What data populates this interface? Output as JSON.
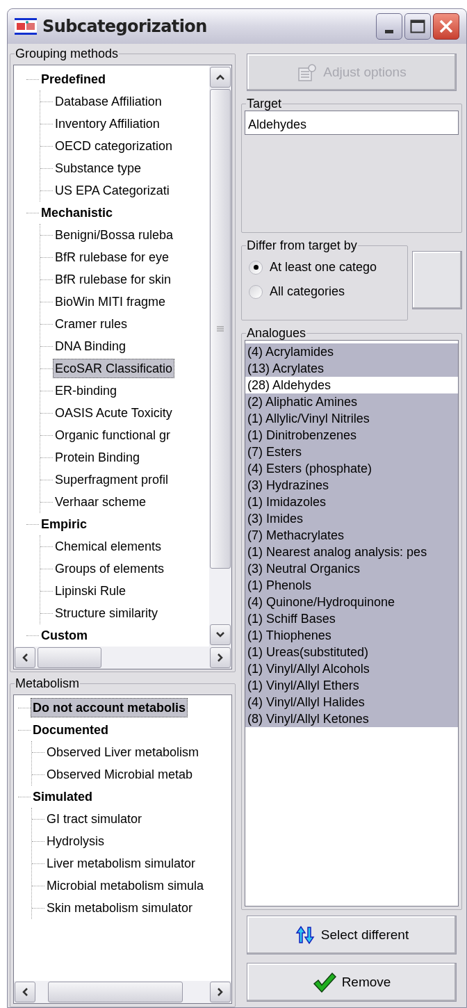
{
  "window": {
    "title": "Subcategorization"
  },
  "grouping_methods": {
    "label": "Grouping methods",
    "tree": [
      {
        "label": "Predefined",
        "selected": false,
        "children": [
          {
            "label": "Database Affiliation",
            "selected": false
          },
          {
            "label": "Inventory Affiliation",
            "selected": false
          },
          {
            "label": "OECD categorization",
            "selected": false
          },
          {
            "label": "Substance type",
            "selected": false
          },
          {
            "label": "US EPA Categorizati",
            "selected": false
          }
        ]
      },
      {
        "label": "Mechanistic",
        "selected": false,
        "children": [
          {
            "label": "Benigni/Bossa ruleba",
            "selected": false
          },
          {
            "label": "BfR rulebase for eye",
            "selected": false
          },
          {
            "label": "BfR rulebase for skin",
            "selected": false
          },
          {
            "label": "BioWin MITI fragme",
            "selected": false
          },
          {
            "label": "Cramer rules",
            "selected": false
          },
          {
            "label": "DNA Binding",
            "selected": false
          },
          {
            "label": "EcoSAR Classificatio",
            "selected": true
          },
          {
            "label": "ER-binding",
            "selected": false
          },
          {
            "label": "OASIS Acute Toxicity",
            "selected": false
          },
          {
            "label": "Organic functional gr",
            "selected": false
          },
          {
            "label": "Protein Binding",
            "selected": false
          },
          {
            "label": "Superfragment profil",
            "selected": false
          },
          {
            "label": "Verhaar scheme",
            "selected": false
          }
        ]
      },
      {
        "label": "Empiric",
        "selected": false,
        "children": [
          {
            "label": "Chemical elements",
            "selected": false
          },
          {
            "label": "Groups of elements",
            "selected": false
          },
          {
            "label": "Lipinski Rule",
            "selected": false
          },
          {
            "label": "Structure similarity",
            "selected": false
          }
        ]
      },
      {
        "label": "Custom",
        "selected": false
      }
    ]
  },
  "metabolism": {
    "label": "Metabolism",
    "tree": [
      {
        "label": "Do not account metabolis",
        "selected": true
      },
      {
        "label": "Documented",
        "selected": false,
        "children": [
          {
            "label": "Observed Liver metabolism",
            "selected": false
          },
          {
            "label": "Observed Microbial metab",
            "selected": false
          }
        ]
      },
      {
        "label": "Simulated",
        "selected": false,
        "children": [
          {
            "label": "GI tract simulator",
            "selected": false
          },
          {
            "label": "Hydrolysis",
            "selected": false
          },
          {
            "label": "Liver metabolism simulator",
            "selected": false
          },
          {
            "label": "Microbial metabolism simula",
            "selected": false
          },
          {
            "label": "Skin metabolism simulator",
            "selected": false
          }
        ]
      }
    ]
  },
  "adjust_options": {
    "label": "Adjust options",
    "disabled": true
  },
  "target": {
    "label": "Target",
    "value": "Aldehydes"
  },
  "differ": {
    "label": "Differ from target by",
    "options": [
      {
        "label": "At least one catego",
        "selected": true
      },
      {
        "label": "All categories",
        "selected": false
      }
    ]
  },
  "analogues": {
    "label": "Analogues",
    "items": [
      {
        "label": "(4) Acrylamides",
        "selected": true
      },
      {
        "label": "(13) Acrylates",
        "selected": true
      },
      {
        "label": "(28) Aldehydes",
        "selected": false
      },
      {
        "label": "(2) Aliphatic Amines",
        "selected": true
      },
      {
        "label": "(1) Allylic/Vinyl Nitriles",
        "selected": true
      },
      {
        "label": "(1) Dinitrobenzenes",
        "selected": true
      },
      {
        "label": "(7) Esters",
        "selected": true
      },
      {
        "label": "(4) Esters (phosphate)",
        "selected": true
      },
      {
        "label": "(3) Hydrazines",
        "selected": true
      },
      {
        "label": "(1) Imidazoles",
        "selected": true
      },
      {
        "label": "(3) Imides",
        "selected": true
      },
      {
        "label": "(7) Methacrylates",
        "selected": true
      },
      {
        "label": "(1) Nearest analog analysis: pes",
        "selected": true
      },
      {
        "label": "(3) Neutral Organics",
        "selected": true
      },
      {
        "label": "(1) Phenols",
        "selected": true
      },
      {
        "label": "(4) Quinone/Hydroquinone",
        "selected": true
      },
      {
        "label": "(1) Schiff Bases",
        "selected": true
      },
      {
        "label": "(1) Thiophenes",
        "selected": true
      },
      {
        "label": "(1) Ureas(substituted)",
        "selected": true
      },
      {
        "label": "(1) Vinyl/Allyl Alcohols",
        "selected": true
      },
      {
        "label": "(1) Vinyl/Allyl Ethers",
        "selected": true
      },
      {
        "label": "(4) Vinyl/Allyl Halides",
        "selected": true
      },
      {
        "label": "(8) Vinyl/Allyl Ketones",
        "selected": true
      }
    ]
  },
  "buttons": [
    {
      "kind": "select",
      "label": "Select different"
    },
    {
      "kind": "remove",
      "label": "Remove"
    }
  ]
}
